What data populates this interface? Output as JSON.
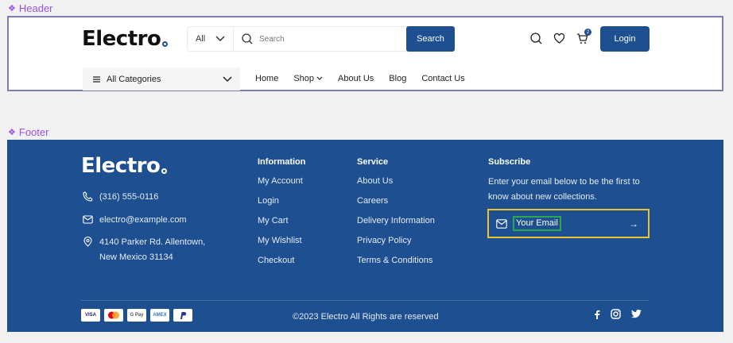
{
  "frames": {
    "header": "Header",
    "footer": "Footer"
  },
  "brand": {
    "name": "Electro",
    "accent": "#1d4f91",
    "footer_bg": "#1d4f91",
    "highlight_yellow": "#e8c435",
    "highlight_green": "#2aa84a"
  },
  "header": {
    "search": {
      "category": "All",
      "placeholder": "Search",
      "button": "Search"
    },
    "icons": [
      "search-icon",
      "heart-icon",
      "cart-icon"
    ],
    "cart_count": "2",
    "login": "Login",
    "categories_label": "All Categories",
    "nav": [
      "Home",
      "Shop",
      "About Us",
      "Blog",
      "Contact Us"
    ]
  },
  "footer": {
    "contact": {
      "phone": "(316) 555-0116",
      "email": "electro@example.com",
      "address_line1": "4140 Parker Rd. Allentown,",
      "address_line2": "New Mexico 31134"
    },
    "information": {
      "title": "Information",
      "links": [
        "My Account",
        "Login",
        "My Cart",
        "My Wishlist",
        "Checkout"
      ]
    },
    "service": {
      "title": "Service",
      "links": [
        "About Us",
        "Careers",
        "Delivery Information",
        "Privacy Policy",
        "Terms & Conditions"
      ]
    },
    "subscribe": {
      "title": "Subscribe",
      "text": "Enter your email below to be the first to know about new collections.",
      "placeholder": "Your Email"
    },
    "payments": [
      "VISA",
      "Mastercard",
      "G Pay",
      "AMEX",
      "PayPal"
    ],
    "copyright": "©2023 Electro All Rights are reserved",
    "socials": [
      "facebook-icon",
      "instagram-icon",
      "twitter-icon"
    ]
  }
}
